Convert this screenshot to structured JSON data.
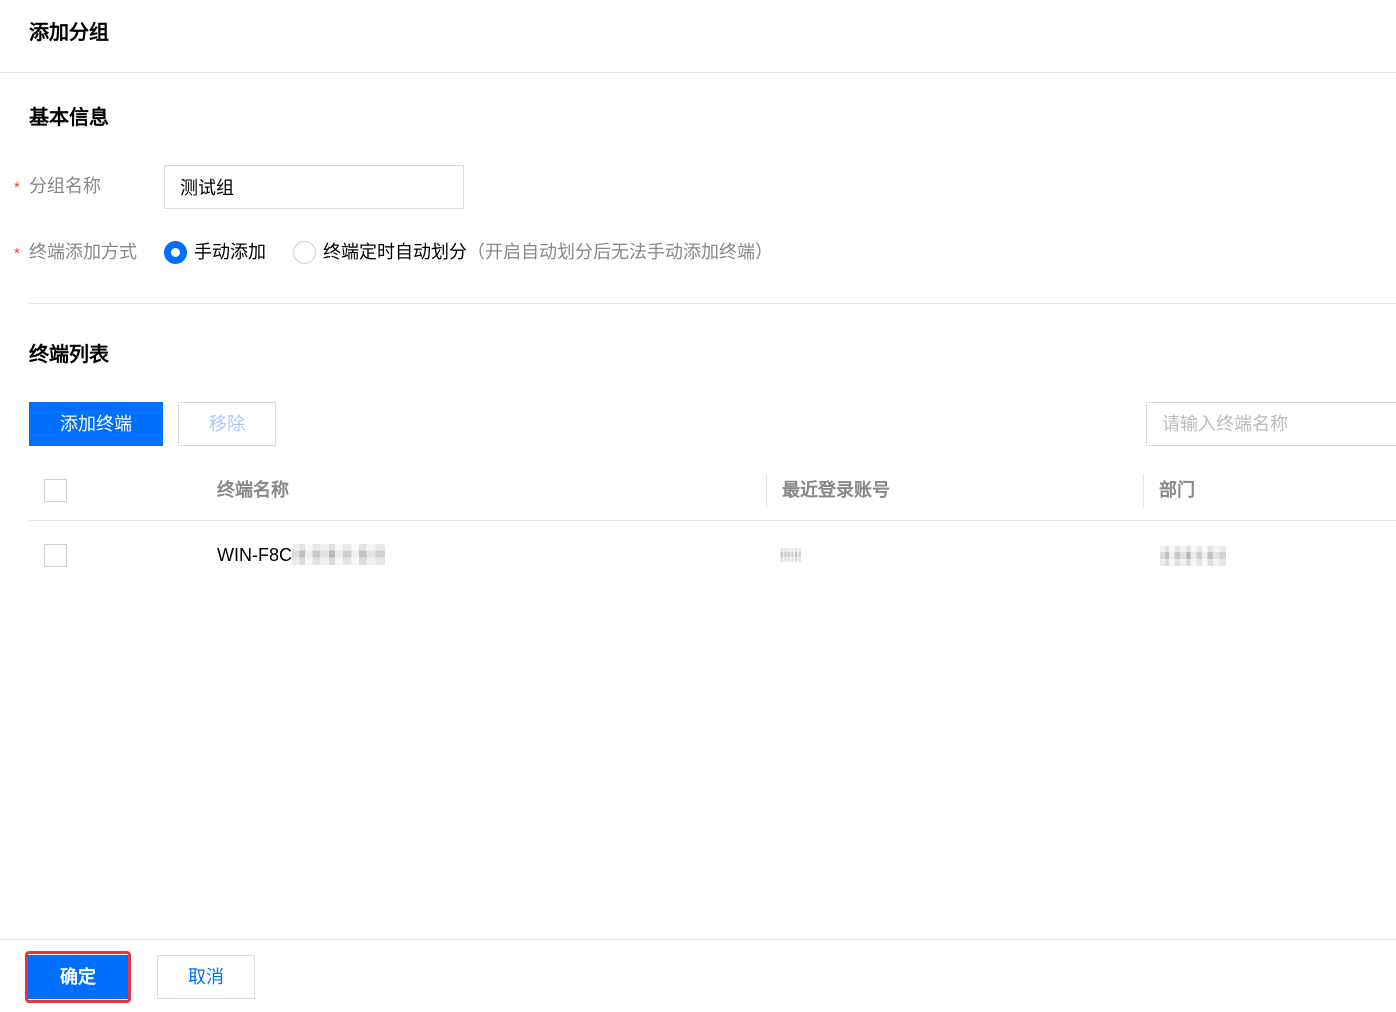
{
  "dialog": {
    "title": "添加分组"
  },
  "basic_info": {
    "section_title": "基本信息",
    "group_name": {
      "required_mark": "*",
      "label": "分组名称",
      "value": "测试组"
    },
    "add_method": {
      "required_mark": "*",
      "label": "终端添加方式",
      "options": [
        {
          "label": "手动添加",
          "checked": true
        },
        {
          "label": "终端定时自动划分",
          "checked": false
        }
      ],
      "hint": "（开启自动划分后无法手动添加终端）"
    }
  },
  "terminal_list": {
    "section_title": "终端列表",
    "add_button": "添加终端",
    "remove_button": "移除",
    "search_placeholder": "请输入终端名称",
    "columns": [
      "终端名称",
      "最近登录账号",
      "部门"
    ],
    "rows": [
      {
        "name": "WIN-F8C",
        "checked": false
      }
    ]
  },
  "footer": {
    "confirm": "确定",
    "cancel": "取消"
  },
  "colors": {
    "primary": "#006eff",
    "required": "#e54545",
    "highlight": "#e8363d"
  }
}
